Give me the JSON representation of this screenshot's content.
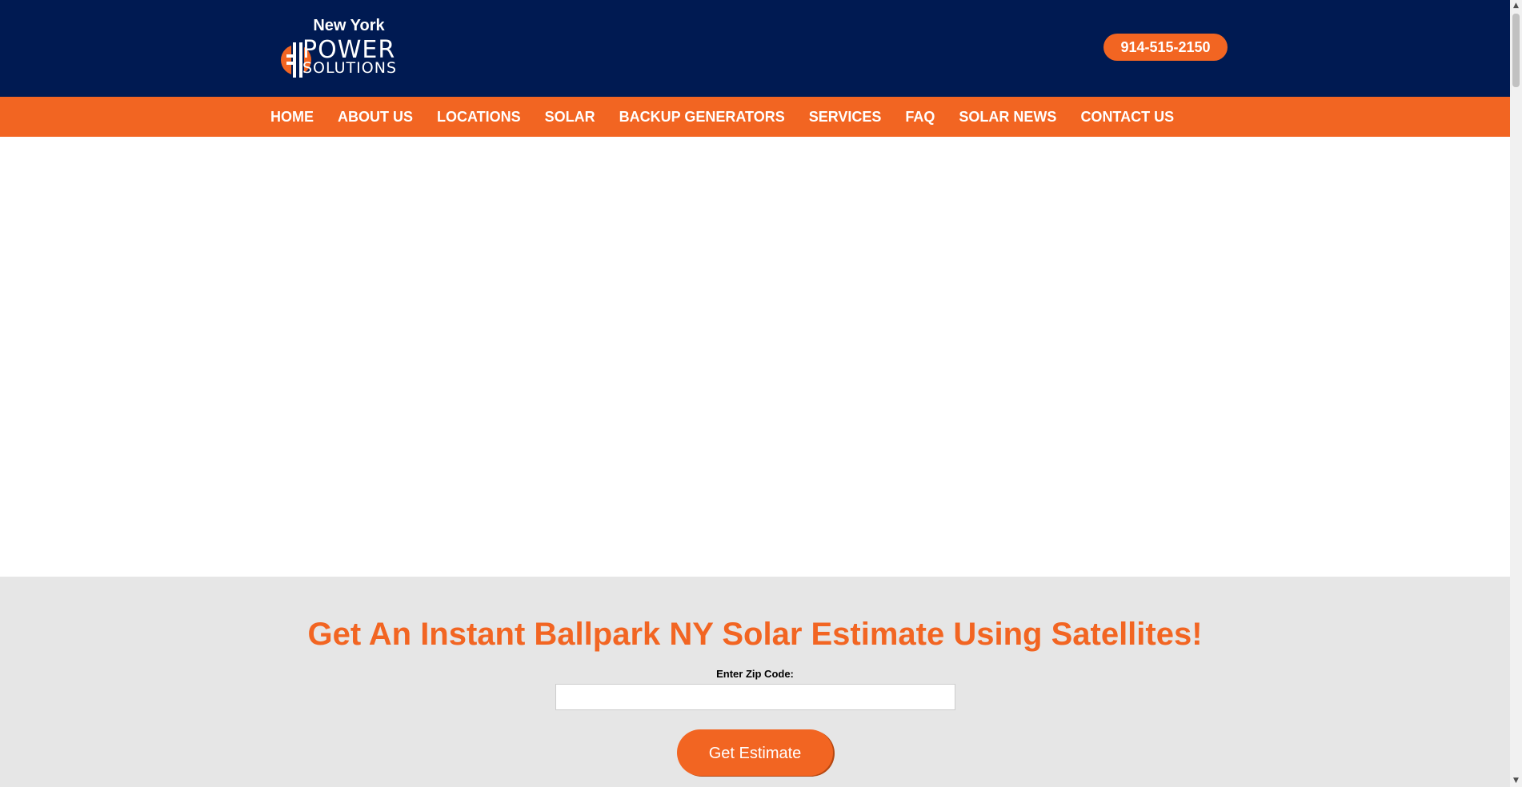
{
  "header": {
    "logo": {
      "region": "New York",
      "word1": "POWER",
      "word2": "SOLUTIONS"
    },
    "phone": "914-515-2150"
  },
  "nav": {
    "items": [
      {
        "label": "HOME"
      },
      {
        "label": "ABOUT US"
      },
      {
        "label": "LOCATIONS"
      },
      {
        "label": "SOLAR"
      },
      {
        "label": "BACKUP GENERATORS"
      },
      {
        "label": "SERVICES"
      },
      {
        "label": "FAQ"
      },
      {
        "label": "SOLAR NEWS"
      },
      {
        "label": "CONTACT US"
      }
    ]
  },
  "estimate": {
    "title": "Get An Instant Ballpark NY Solar Estimate Using Satellites!",
    "zip_label": "Enter Zip Code:",
    "zip_value": "",
    "button_label": "Get Estimate"
  },
  "colors": {
    "header_bg": "#001a52",
    "accent": "#f26522",
    "section_bg": "#e6e6e6"
  },
  "icons": {
    "logo_mark": "plug-icon",
    "scroll_up": "scroll-up-arrow-icon",
    "scroll_down": "scroll-down-arrow-icon"
  }
}
